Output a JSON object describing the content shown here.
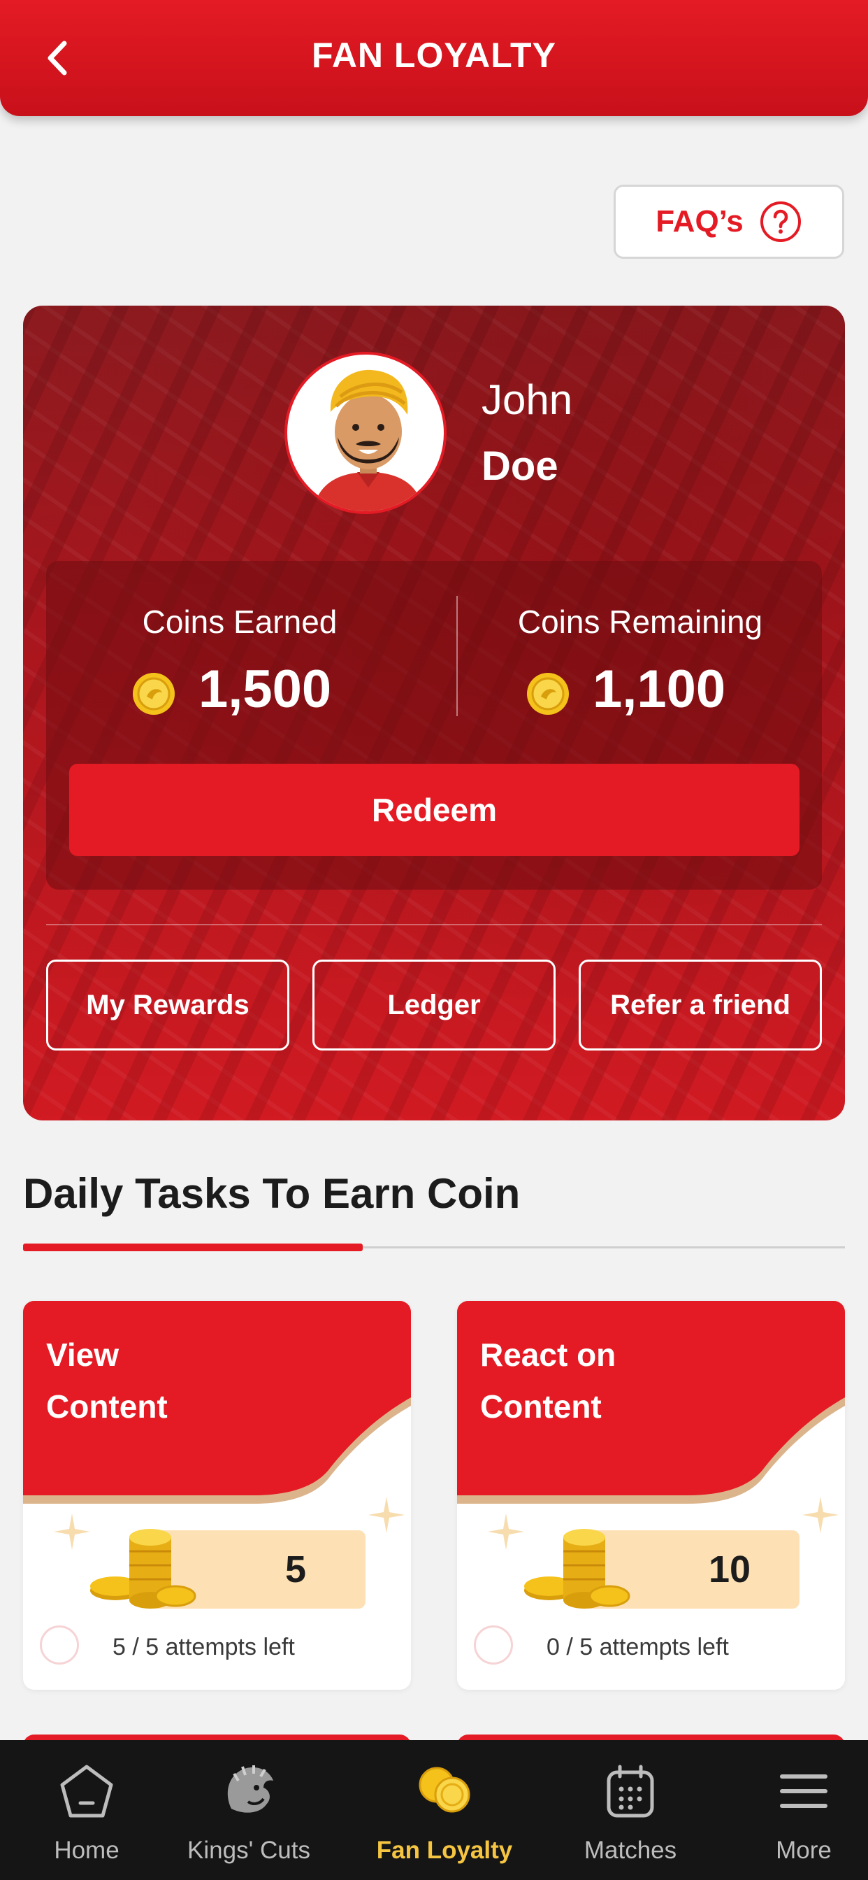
{
  "header": {
    "title": "FAN LOYALTY"
  },
  "faq": {
    "label": "FAQ’s"
  },
  "profile": {
    "first_name": "John",
    "last_name": "Doe"
  },
  "coins": {
    "earned_label": "Coins Earned",
    "earned_value": "1,500",
    "remaining_label": "Coins Remaining",
    "remaining_value": "1,100"
  },
  "actions": {
    "redeem": "Redeem",
    "my_rewards": "My Rewards",
    "ledger": "Ledger",
    "refer": "Refer a friend"
  },
  "tasks_section": {
    "title": "Daily Tasks To Earn Coin",
    "tasks": [
      {
        "title_line1": "View",
        "title_line2": "Content",
        "reward": "5",
        "attempts": "5 / 5 attempts left"
      },
      {
        "title_line1": "React on",
        "title_line2": "Content",
        "reward": "10",
        "attempts": "0 / 5 attempts left"
      }
    ]
  },
  "nav": {
    "items": [
      {
        "label": "Home",
        "icon": "home-icon"
      },
      {
        "label": "Kings' Cuts",
        "icon": "lion-icon"
      },
      {
        "label": "Fan Loyalty",
        "icon": "coins-icon",
        "active": true
      },
      {
        "label": "Matches",
        "icon": "calendar-icon"
      },
      {
        "label": "More",
        "icon": "menu-icon"
      }
    ]
  },
  "colors": {
    "brand_red": "#e41b24",
    "active_nav": "#f5c542",
    "nav_bg": "#151515"
  }
}
